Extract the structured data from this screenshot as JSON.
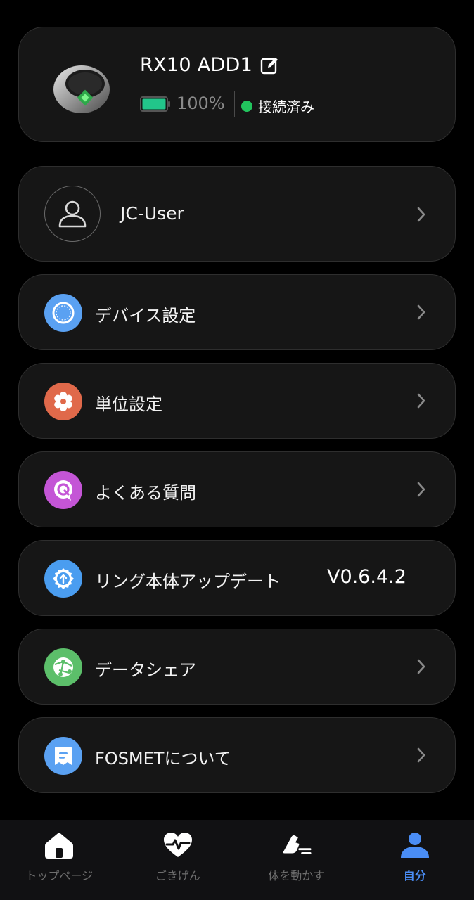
{
  "device": {
    "name": "RX10 ADD1",
    "battery_percent": "100%",
    "battery_level": 1.0,
    "status": "接続済み",
    "status_color": "#22c55e",
    "battery_color": "#22c58a"
  },
  "user": {
    "name": "JC-User"
  },
  "menu": [
    {
      "label": "デバイス設定",
      "icon": "ring-settings-icon",
      "color": "#5aa1f2"
    },
    {
      "label": "単位設定",
      "icon": "gear-icon",
      "color": "#e0694a"
    },
    {
      "label": "よくある質問",
      "icon": "faq-q-icon",
      "color": "#c455d6"
    },
    {
      "label": "リング本体アップデート",
      "icon": "update-icon",
      "color": "#4a9df0",
      "value": "V0.6.4.2"
    },
    {
      "label": "データシェア",
      "icon": "share-globe-icon",
      "color": "#5cbf6a"
    },
    {
      "label": "FOSMETについて",
      "icon": "about-doc-icon",
      "color": "#5aa1f2"
    }
  ],
  "nav": [
    {
      "label": "トップページ",
      "icon": "home-icon"
    },
    {
      "label": "ごきげん",
      "icon": "heart-pulse-icon"
    },
    {
      "label": "体を動かす",
      "icon": "running-shoe-icon"
    },
    {
      "label": "自分",
      "icon": "person-icon",
      "active": true
    }
  ],
  "colors": {
    "accent": "#4a8df5",
    "card_bg": "#161616",
    "page_bg": "#000000"
  }
}
